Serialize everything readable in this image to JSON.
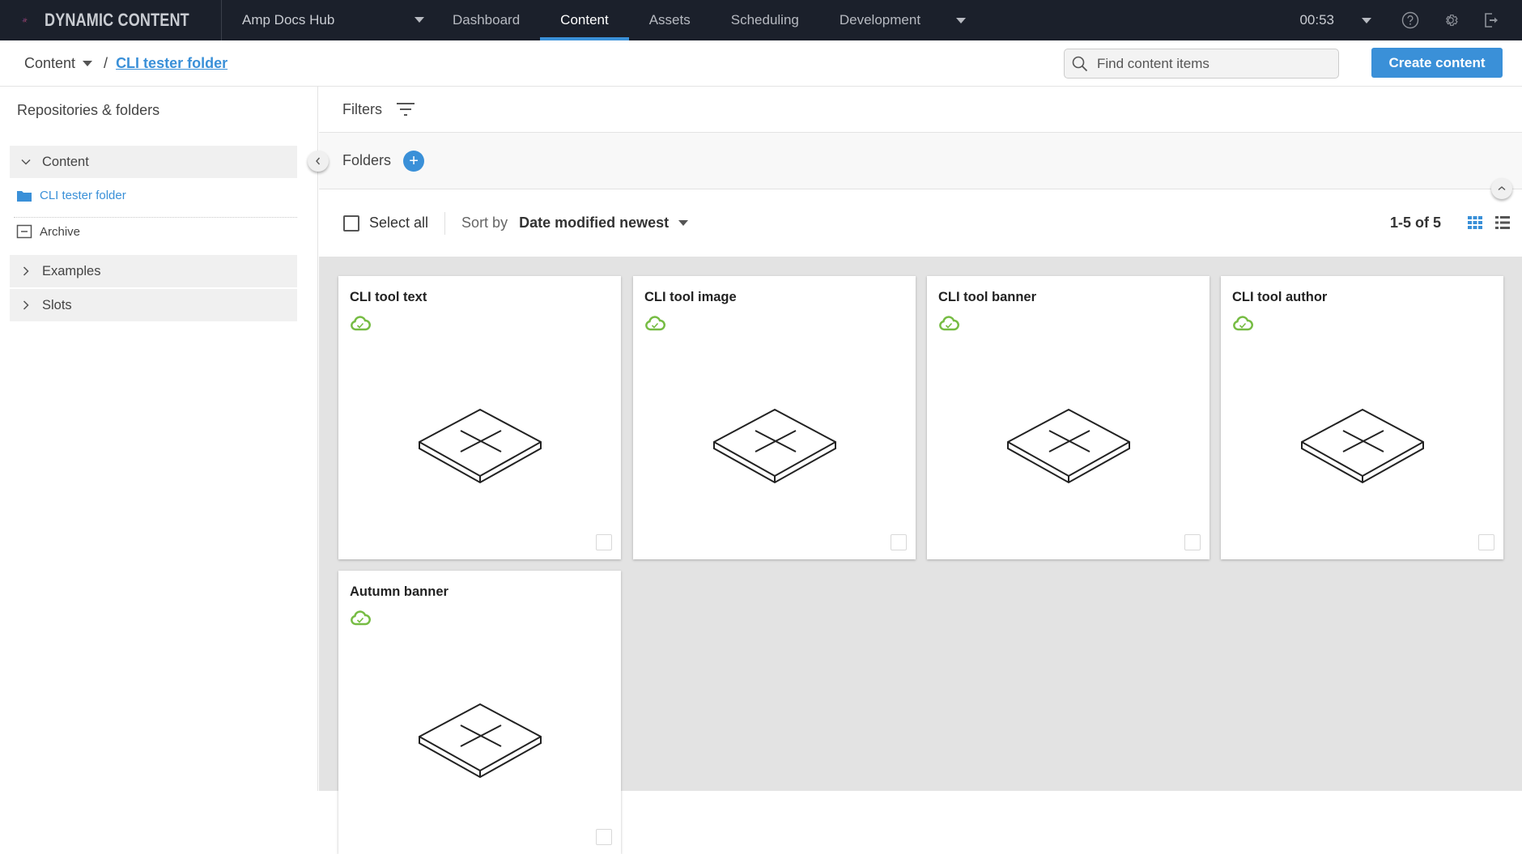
{
  "app": {
    "brand": "DYNAMIC CONTENT",
    "hub": "Amp Docs Hub",
    "nav_tabs": [
      {
        "label": "Dashboard",
        "active": false
      },
      {
        "label": "Content",
        "active": true
      },
      {
        "label": "Assets",
        "active": false
      },
      {
        "label": "Scheduling",
        "active": false
      },
      {
        "label": "Development",
        "active": false
      }
    ],
    "time": "00:53",
    "icons": {
      "help": "help-circle-icon",
      "settings": "gear-icon",
      "logout": "logout-icon"
    }
  },
  "subheader": {
    "breadcrumb_root": "Content",
    "breadcrumb_separator": "/",
    "breadcrumb_current": "CLI tester folder",
    "search_placeholder": "Find content items",
    "search_value": "",
    "create_label": "Create content"
  },
  "sidebar": {
    "title": "Repositories & folders",
    "repos": [
      {
        "label": "Content",
        "expanded": true
      },
      {
        "label": "Examples",
        "expanded": false
      },
      {
        "label": "Slots",
        "expanded": false
      }
    ],
    "folder": "CLI tester folder",
    "archive": "Archive"
  },
  "main": {
    "filters_label": "Filters",
    "folders_label": "Folders",
    "add_folder_symbol": "+",
    "select_all_label": "Select all",
    "sort_label": "Sort by",
    "sort_value": "Date modified newest",
    "count": "1-5 of 5",
    "view_mode": "grid",
    "items": [
      {
        "title": "CLI tool text",
        "status": "published"
      },
      {
        "title": "CLI tool image",
        "status": "published"
      },
      {
        "title": "CLI tool banner",
        "status": "published"
      },
      {
        "title": "CLI tool author",
        "status": "published"
      },
      {
        "title": "Autumn banner",
        "status": "published"
      }
    ]
  },
  "colors": {
    "accent": "#3a90d8",
    "topbar": "#1b202b",
    "status_published": "#76bc43",
    "grid_background": "#e3e3e3"
  }
}
